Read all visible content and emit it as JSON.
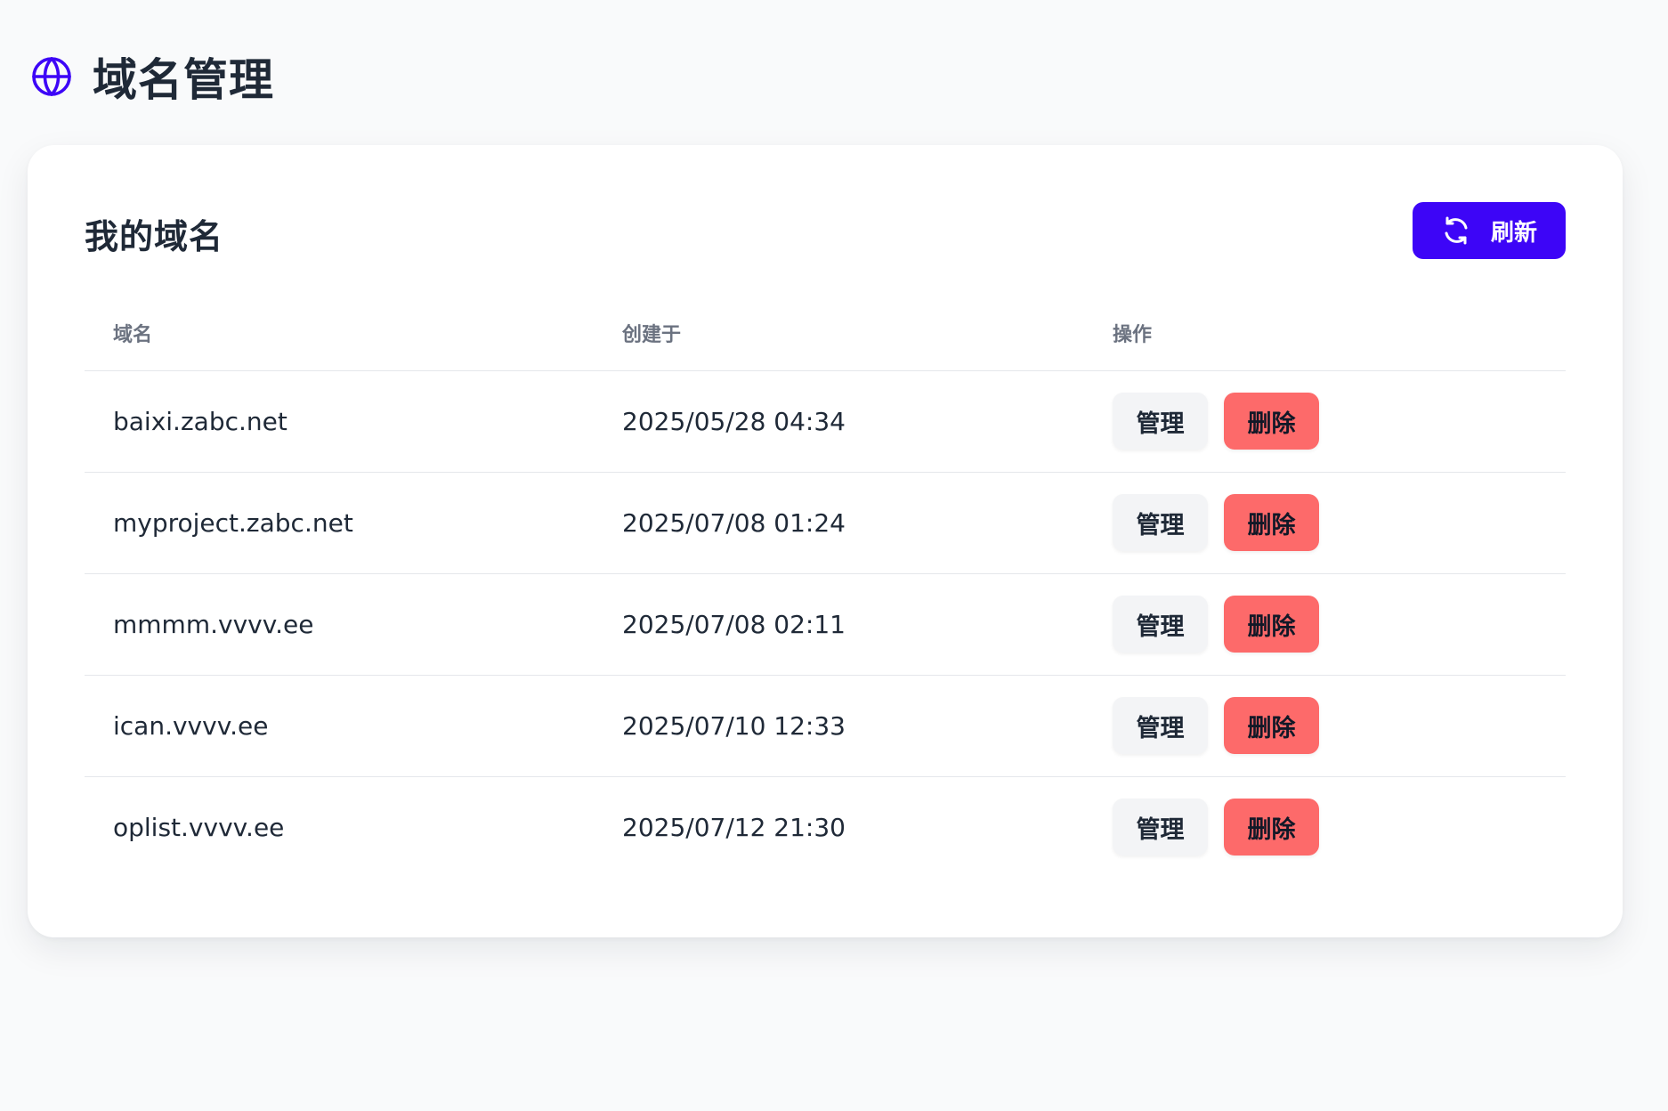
{
  "page": {
    "title": "域名管理",
    "title_icon": "globe-icon",
    "accent_color": "#3d05f7"
  },
  "card": {
    "title": "我的域名",
    "refresh_label": "刷新",
    "refresh_icon": "refresh-icon"
  },
  "table": {
    "headers": {
      "domain": "域名",
      "created": "创建于",
      "actions": "操作"
    },
    "manage_label": "管理",
    "delete_label": "删除",
    "delete_color": "#fd6a6a",
    "rows": [
      {
        "domain": "baixi.zabc.net",
        "created": "2025/05/28 04:34"
      },
      {
        "domain": "myproject.zabc.net",
        "created": "2025/07/08 01:24"
      },
      {
        "domain": "mmmm.vvvv.ee",
        "created": "2025/07/08 02:11"
      },
      {
        "domain": "ican.vvvv.ee",
        "created": "2025/07/10 12:33"
      },
      {
        "domain": "oplist.vvvv.ee",
        "created": "2025/07/12 21:30"
      }
    ]
  }
}
